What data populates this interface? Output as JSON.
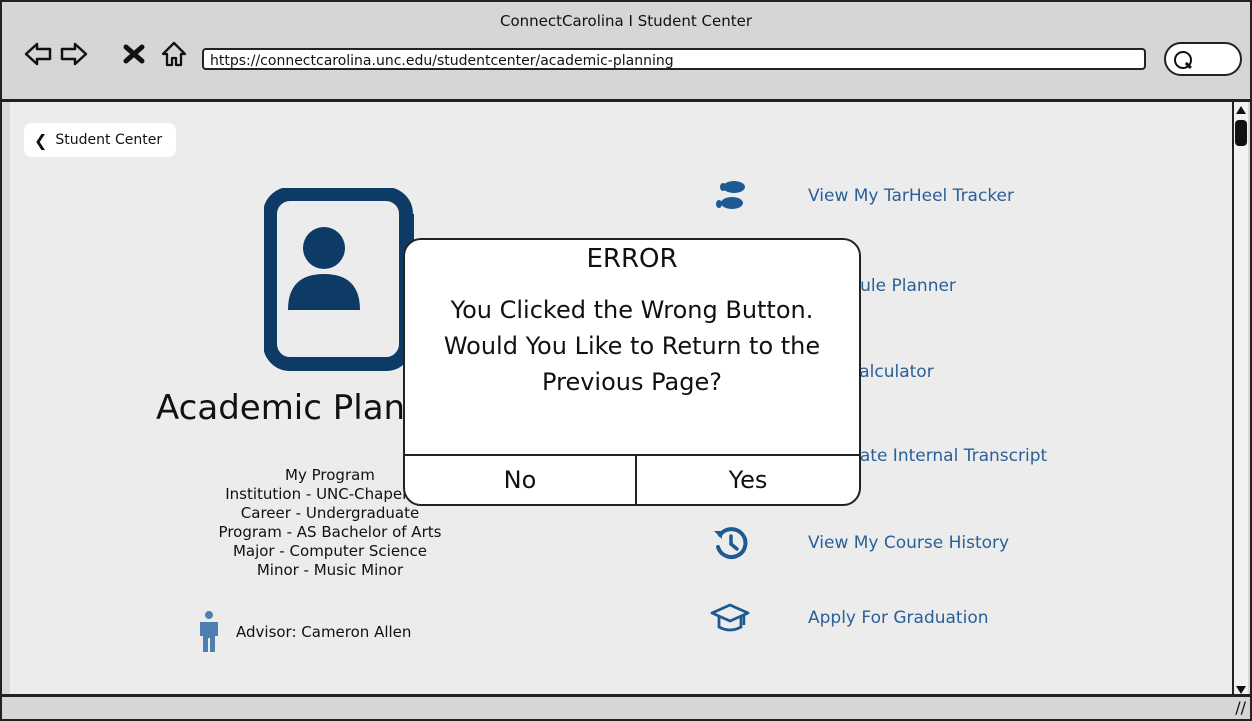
{
  "browser": {
    "title": "ConnectCarolina I Student Center",
    "url": "https://connectcarolina.unc.edu/studentcenter/academic-planning"
  },
  "page": {
    "back_label": "Student Center",
    "title": "Academic Planning",
    "program": {
      "heading": "My Program",
      "institution": "Institution - UNC-Chapel Hill",
      "career": "Career - Undergraduate",
      "program": "Program - AS Bachelor of Arts",
      "major": "Major - Computer Science",
      "minor": "Minor - Music Minor"
    },
    "advisor": "Advisor: Cameron Allen",
    "links": [
      {
        "label": "View My TarHeel Tracker",
        "icon": "footprints-icon"
      },
      {
        "label": "Schedule Planner",
        "icon": "calendar-icon"
      },
      {
        "label": "GPA Calculator",
        "icon": "calculator-icon"
      },
      {
        "label": "Generate Internal Transcript",
        "icon": "document-icon"
      },
      {
        "label": "View My Course History",
        "icon": "history-icon"
      },
      {
        "label": "Apply For Graduation",
        "icon": "graduation-cap-icon"
      }
    ]
  },
  "modal": {
    "title": "ERROR",
    "line1": "You Clicked the Wrong Button.",
    "line2": "Would You Like to Return to the",
    "line3": "Previous Page?",
    "no_label": "No",
    "yes_label": "Yes"
  },
  "colors": {
    "accent": "#2a5f97",
    "icon_dark": "#0e3a66",
    "icon_mid": "#1e5a92"
  }
}
